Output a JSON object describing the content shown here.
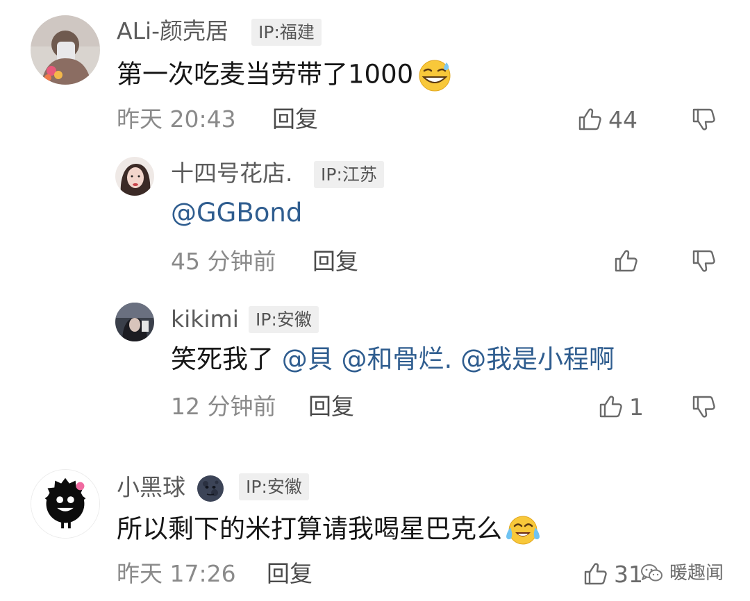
{
  "comments": [
    {
      "username": "ALi-颜壳居",
      "ip": "IP:福建",
      "text": "第一次吃麦当劳带了1000",
      "emoji": "grinning-sweat-emoji",
      "time": "昨天 20:43",
      "reply_label": "回复",
      "likes": "44"
    },
    {
      "username": "十四号花店.",
      "ip": "IP:江苏",
      "mention": "@GGBond",
      "time": "45 分钟前",
      "reply_label": "回复",
      "likes": ""
    },
    {
      "username": "kikimi",
      "ip": "IP:安徽",
      "text": "笑死我了",
      "mentions": [
        "@貝",
        "@和骨烂.",
        "@我是小程啊"
      ],
      "time": "12 分钟前",
      "reply_label": "回复",
      "likes": "1"
    },
    {
      "username": "小黑球",
      "username_emoji": "new-moon-face-emoji",
      "ip": "IP:安徽",
      "text": "所以剩下的米打算请我喝星巴克么",
      "emoji": "tears-of-joy-emoji",
      "time": "昨天 17:26",
      "reply_label": "回复",
      "likes": "31"
    }
  ],
  "watermark": {
    "text": "暖趣闻",
    "icon": "wechat-icon"
  },
  "colors": {
    "mention": "#2f5d8f",
    "badge_bg": "#efefef",
    "meta": "#8a8a8a"
  }
}
